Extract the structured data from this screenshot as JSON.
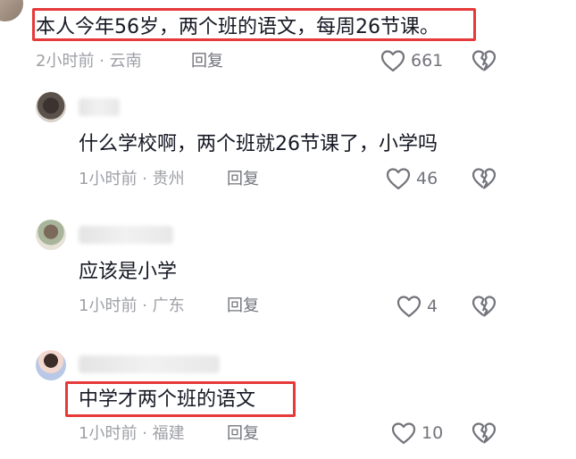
{
  "comments": [
    {
      "text": "本人今年56岁，两个班的语文，每周26节课。",
      "time": "2小时前",
      "location": "云南",
      "reply_label": "回复",
      "likes": "661"
    },
    {
      "text": "什么学校啊，两个班就26节课了，小学吗",
      "time": "1小时前",
      "location": "贵州",
      "reply_label": "回复",
      "likes": "46"
    },
    {
      "text": "应该是小学",
      "time": "1小时前",
      "location": "广东",
      "reply_label": "回复",
      "likes": "4"
    },
    {
      "text": "中学才两个班的语文",
      "time": "1小时前",
      "location": "福建",
      "reply_label": "回复",
      "likes": "10"
    }
  ],
  "meta_separator": "·",
  "icons": {
    "like": "heart-outline-icon",
    "dislike": "broken-heart-icon"
  },
  "colors": {
    "highlight_border": "#e5393a",
    "meta_text": "#9ea0a6",
    "icon": "#73747b"
  }
}
